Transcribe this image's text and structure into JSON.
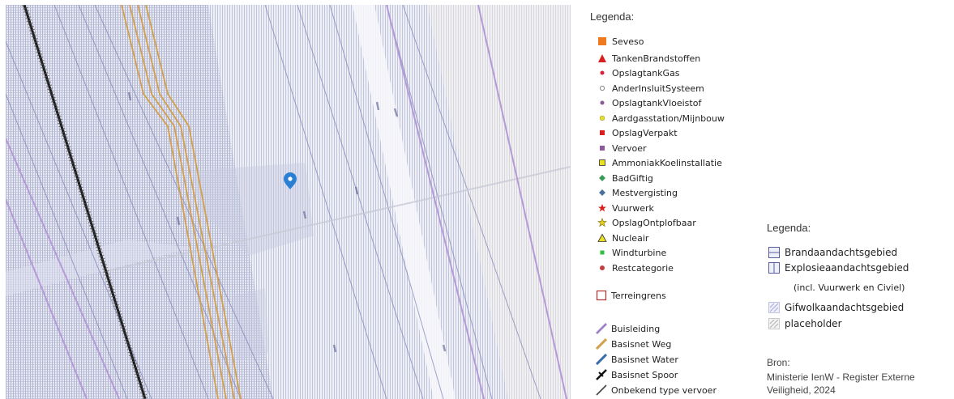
{
  "map": {
    "marker_icon": "map-pin-icon",
    "colors": {
      "base": "#eef0f6",
      "hatch": "#b9bdd9",
      "buisleiding": "#b59ad8",
      "basisnet_weg": "#d2a04a",
      "spoor": "#1b1b1b",
      "marker": "#2a7fd4"
    }
  },
  "legend_points": {
    "title": "Legenda:",
    "items": [
      {
        "label": "Seveso",
        "icon": "square-icon",
        "color": "#f07a20"
      },
      {
        "label": "TankenBrandstoffen",
        "icon": "triangle-icon",
        "color": "#d82020"
      },
      {
        "label": "OpslagtankGas",
        "icon": "dot-icon",
        "color": "#e01e3c"
      },
      {
        "label": "AnderInsluitSysteem",
        "icon": "circle-outline-icon",
        "color": "#888888"
      },
      {
        "label": "OpslagtankVloeistof",
        "icon": "dot-icon",
        "color": "#8a5a9a"
      },
      {
        "label": "Aardgasstation/Mijnbouw",
        "icon": "circle-icon",
        "color": "#e8e030"
      },
      {
        "label": "OpslagVerpakt",
        "icon": "small-square-icon",
        "color": "#d81e1e"
      },
      {
        "label": "Vervoer",
        "icon": "small-square-icon",
        "color": "#8a5a9a"
      },
      {
        "label": "AmmoniakKoelinstallatie",
        "icon": "square-outline-icon",
        "color": "#e8e020"
      },
      {
        "label": "BadGiftig",
        "icon": "diamond-icon",
        "color": "#3a9a5a"
      },
      {
        "label": "Mestvergisting",
        "icon": "diamond-icon",
        "color": "#4a70a0"
      },
      {
        "label": "Vuurwerk",
        "icon": "star-icon",
        "color": "#d81e1e"
      },
      {
        "label": "OpslagOntplofbaar",
        "icon": "star-outline-icon",
        "color": "#e8d020"
      },
      {
        "label": "Nucleair",
        "icon": "triangle-outline-icon",
        "color": "#e8e020"
      },
      {
        "label": "Windturbine",
        "icon": "small-square-icon",
        "color": "#30c040"
      },
      {
        "label": "Restcategorie",
        "icon": "dot-icon",
        "color": "#c04040"
      }
    ],
    "terrein": {
      "label": "Terreingrens",
      "icon": "square-outline-icon",
      "color": "#b03030"
    },
    "lines": [
      {
        "label": "Buisleiding",
        "icon": "line-icon",
        "color": "#b59ad8"
      },
      {
        "label": "Basisnet Weg",
        "icon": "line-icon",
        "color": "#d2a04a"
      },
      {
        "label": "Basisnet Water",
        "icon": "line-icon",
        "color": "#3a6ea8"
      },
      {
        "label": "Basisnet Spoor",
        "icon": "railway-icon",
        "color": "#111111"
      },
      {
        "label": "Onbekend type vervoer",
        "icon": "line-icon",
        "color": "#444444"
      }
    ]
  },
  "legend_areas": {
    "title": "Legenda:",
    "items": [
      {
        "label": "Brandaandachtsgebied",
        "icon": "horizontal-hatch-icon",
        "color": "#5a5aa0"
      },
      {
        "label": "Explosieaandachtsgebied",
        "icon": "vertical-hatch-icon",
        "color": "#5a5aa0"
      },
      {
        "label": "(incl. Vuurwerk en Civiel)",
        "icon": "",
        "color": ""
      },
      {
        "label": "Gifwolkaandachtsgebied",
        "icon": "diagonal-hatch-icon",
        "color": "#a8a8d8"
      },
      {
        "label": "placeholder",
        "icon": "diagonal-hatch-icon",
        "color": "#b0b0b0"
      }
    ]
  },
  "source": {
    "title": "Bron:",
    "text": "Ministerie IenW - Register Externe Veiligheid, 2024"
  }
}
